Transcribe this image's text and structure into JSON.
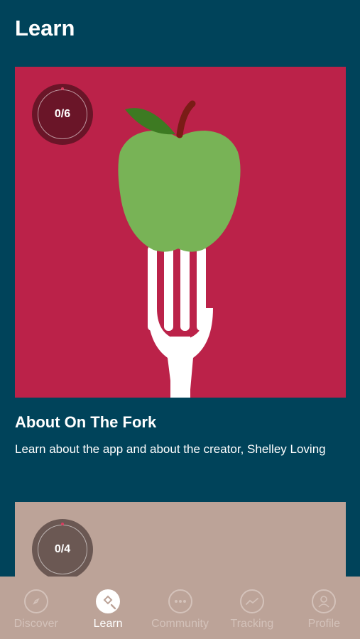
{
  "header": {
    "title": "Learn"
  },
  "cards": [
    {
      "progress": "0/6",
      "title": "About On The Fork",
      "description": "Learn about the app and about the creator, Shelley Loving",
      "colors": {
        "background": "#bb2249",
        "ring": "#6a1528"
      }
    },
    {
      "progress": "0/4",
      "colors": {
        "background": "#bca398",
        "ring": "#6b5853"
      }
    }
  ],
  "bottom_nav": {
    "items": [
      {
        "label": "Discover",
        "icon": "compass-icon",
        "active": false
      },
      {
        "label": "Learn",
        "icon": "learn-search-icon",
        "active": true
      },
      {
        "label": "Community",
        "icon": "chat-bubble-icon",
        "active": false
      },
      {
        "label": "Tracking",
        "icon": "chart-icon",
        "active": false
      },
      {
        "label": "Profile",
        "icon": "person-icon",
        "active": false
      }
    ]
  },
  "colors": {
    "background": "#00435a",
    "nav_background": "#bca398"
  }
}
